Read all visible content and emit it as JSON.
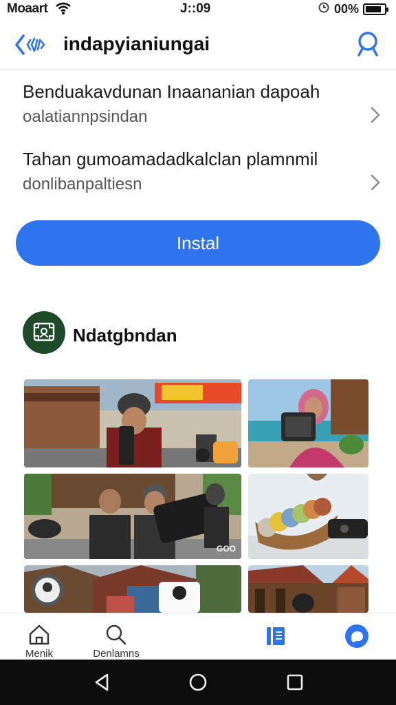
{
  "status_bar": {
    "carrier": "Moaart",
    "time": "J::09",
    "battery_text": "00%",
    "battery_level": 0.85,
    "icons": [
      "wifi-icon",
      "alarm-icon",
      "battery-icon"
    ]
  },
  "header": {
    "title": "indapyianiungai",
    "back_icon": "back-chevron-icon",
    "search_icon": "search-icon"
  },
  "rows": [
    {
      "line1": "Benduakavdunan Inaananian dapoah",
      "line2": "oalatiannpsindan"
    },
    {
      "line1": "Tahan gumoamadadkalclan plamnmil",
      "line2": "donlibanpaltiesn"
    }
  ],
  "install_button": {
    "label": "Instal"
  },
  "section": {
    "title": "Ndatgbndan",
    "avatar_icon": "gallery-frame-icon"
  },
  "photos": [
    {
      "name": "photo-street-rider"
    },
    {
      "name": "photo-woman-device"
    },
    {
      "name": "photo-men-phone"
    },
    {
      "name": "photo-basket-items"
    },
    {
      "name": "photo-village-street"
    },
    {
      "name": "photo-wooden-houses"
    }
  ],
  "photo_overlay_text": "GOO",
  "tab_bar": {
    "tabs": [
      {
        "label": "Menik",
        "icon": "home-icon"
      },
      {
        "label": "Denlamns",
        "icon": "search-icon"
      },
      {
        "label": "",
        "icon": "book-icon"
      },
      {
        "label": "",
        "icon": "chat-bubble-icon"
      }
    ]
  },
  "nav_bar": {
    "icons": [
      "back-triangle-icon",
      "home-circle-icon",
      "recents-square-icon"
    ]
  },
  "colors": {
    "accent": "#2f73ef",
    "avatar_bg": "#1f4a2a",
    "nav_bg": "#0c0c0c"
  }
}
